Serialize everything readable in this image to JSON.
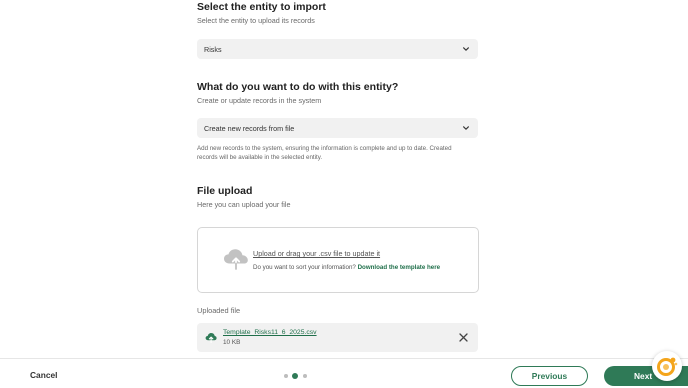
{
  "entity_section": {
    "title": "Select the entity to import",
    "subtitle": "Select the entity to upload its records",
    "selected": "Risks"
  },
  "action_section": {
    "title": "What do you want to do with this entity?",
    "subtitle": "Create or update records in the system",
    "selected": "Create new records from file",
    "help_line1": "Add new records to the system, ensuring the information is complete and up to date. Created",
    "help_line2": "records will be available in the selected entity."
  },
  "upload_section": {
    "title": "File upload",
    "subtitle": "Here you can upload your file",
    "dropzone_main": "Upload or drag your .csv file to update it",
    "dropzone_question": "Do you want to sort your information?",
    "dropzone_link": "Download the template here"
  },
  "uploaded": {
    "label": "Uploaded file",
    "file_name": "Template_Risks11_6_2025.csv",
    "file_size": "10 KB"
  },
  "footer": {
    "cancel": "Cancel",
    "previous": "Previous",
    "next": "Next",
    "steps_total": 3,
    "step_current": 2
  },
  "colors": {
    "accent": "#2f7a57",
    "field_bg": "#f1f1f1",
    "cloud": "#c2c2c2"
  },
  "icons": [
    "chevron-down-icon",
    "cloud-upload-icon",
    "cloud-file-icon",
    "close-icon",
    "assistant-icon"
  ]
}
